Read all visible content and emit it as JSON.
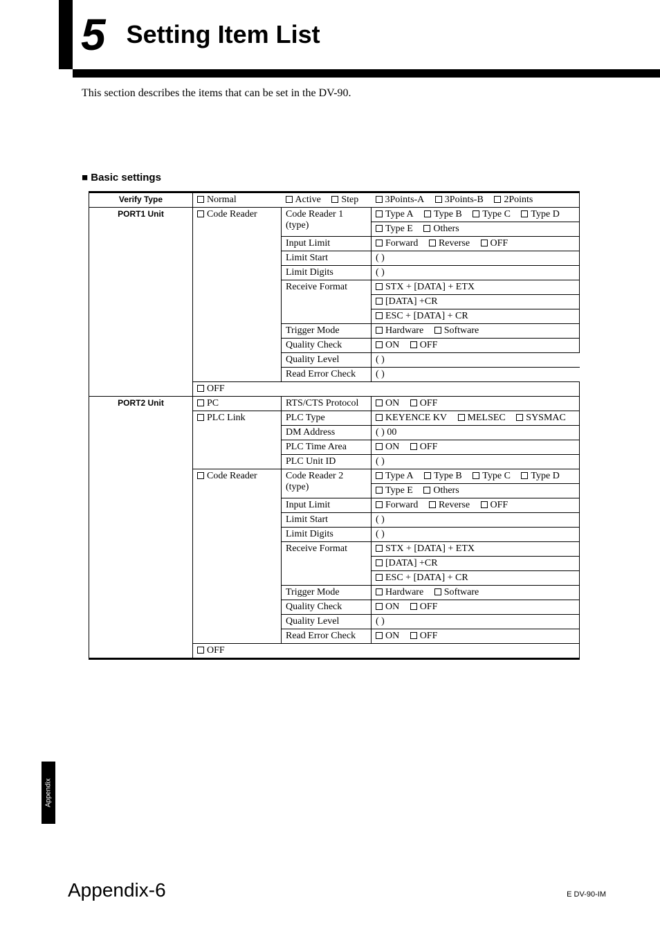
{
  "chapter_number": "5",
  "chapter_title": "Setting Item List",
  "intro": "This section describes the items that can be set in the DV-90.",
  "section_basic": "Basic settings",
  "side_tab": "Appendix",
  "page_number": "Appendix-6",
  "doc_id": "E DV-90-IM",
  "labels": {
    "verify_type": "Verify Type",
    "port1_unit": "PORT1 Unit",
    "port2_unit": "PORT2 Unit",
    "normal": "Normal",
    "active": "Active",
    "step": "Step",
    "3pa": "3Points-A",
    "3pb": "3Points-B",
    "2p": "2Points",
    "code_reader": "Code Reader",
    "code_reader1_type": "Code Reader 1 (type)",
    "code_reader2_type": "Code Reader 2 (type)",
    "type_a": "Type A",
    "type_b": "Type B",
    "type_c": "Type C",
    "type_d": "Type D",
    "type_e": "Type E",
    "others": "Others",
    "input_limit": "Input Limit",
    "forward": "Forward",
    "reverse": "Reverse",
    "off": "OFF",
    "on": "ON",
    "limit_start": "Limit Start",
    "limit_digits": "Limit Digits",
    "receive_format": "Receive Format",
    "rf1": "STX + [DATA] + ETX",
    "rf2": "[DATA] +CR",
    "rf3": "ESC + [DATA] + CR",
    "trigger_mode": "Trigger Mode",
    "hardware": "Hardware",
    "software": "Software",
    "quality_check": "Quality Check",
    "quality_level": "Quality Level",
    "read_error_check": "Read Error Check",
    "pc": "PC",
    "rts_cts": "RTS/CTS Protocol",
    "plc_link": "PLC Link",
    "plc_type": "PLC Type",
    "keyence_kv": "KEYENCE KV",
    "melsec": "MELSEC",
    "sysmac": "SYSMAC",
    "dm_address": "DM Address",
    "dm_val": "(                 )    00",
    "plc_time_area": "PLC Time Area",
    "plc_unit_id": "PLC Unit ID",
    "paren_short": "(                 )",
    "paren_long": "(                           )"
  }
}
